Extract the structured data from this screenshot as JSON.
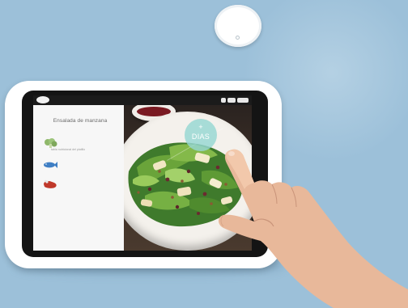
{
  "status_bar": {
    "icon_logo": "cloud-logo-icon",
    "icons": [
      "wifi-icon",
      "signal-icon",
      "battery-icon"
    ]
  },
  "sidebar": {
    "recipe_title": "Ensalada de manzana",
    "nutrition_info_text": "tabla nutricional del platillo",
    "categories": [
      {
        "icon": "broccoli-icon",
        "color": "#8fb86a"
      },
      {
        "icon": "fish-icon",
        "color": "#3f7fc4"
      },
      {
        "icon": "meat-icon",
        "color": "#c0392b"
      }
    ]
  },
  "badge": {
    "plus": "+",
    "label": "DIAS",
    "color": "#96d7d2"
  },
  "colors": {
    "background": "#9cc0d9",
    "screen_bezel": "#ffffff",
    "frame": "#141414"
  }
}
